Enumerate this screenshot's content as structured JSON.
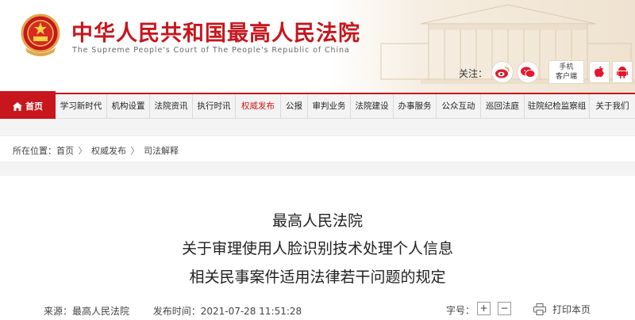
{
  "header": {
    "title": "中华人民共和国最高人民法院",
    "subtitle": "The Supreme People's Court of The People's Republic of China",
    "follow_label": "关注：",
    "mobile_client_line1": "手机",
    "mobile_client_line2": "客户端",
    "icons": [
      "court-emblem-icon",
      "weibo-icon",
      "wechat-icon",
      "apple-icon",
      "android-icon"
    ]
  },
  "nav": {
    "home": "首页",
    "items": [
      "学习新时代",
      "机构设置",
      "法院资讯",
      "执行时讯",
      "权威发布",
      "公报",
      "审判业务",
      "法院建设",
      "办事服务",
      "公众互动",
      "巡回法庭",
      "驻院纪检监察组",
      "关于我们"
    ],
    "active_index": 4
  },
  "breadcrumb": {
    "prefix": "所在位置：",
    "items": [
      "首页",
      "权威发布",
      "司法解释"
    ],
    "separator": "〉"
  },
  "article": {
    "title_line1": "最高人民法院",
    "title_line2": "关于审理使用人脸识别技术处理个人信息",
    "title_line3": "相关民事案件适用法律若干问题的规定",
    "source_label": "来源：",
    "source": "最高人民法院",
    "time_label": "发布时间：",
    "time": "2021-07-28 11:51:28",
    "font_size_label": "字号：",
    "font_increase": "+",
    "font_decrease": "−",
    "print_label": "打印本页"
  },
  "colors": {
    "brand_red": "#c8161d",
    "nav_bg": "#f3f3f3",
    "page_bg": "#f4f4f4"
  }
}
